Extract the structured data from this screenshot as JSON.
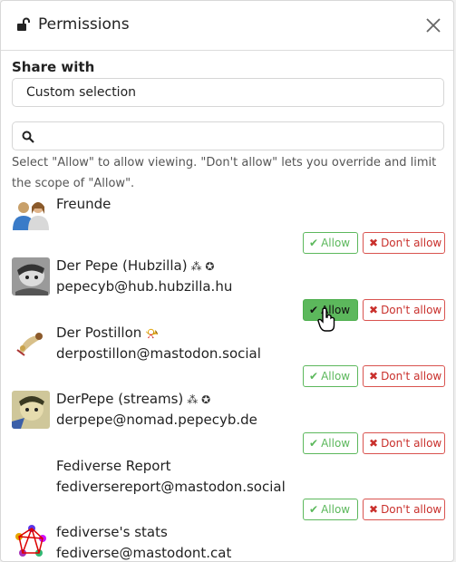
{
  "dialog": {
    "title": "Permissions",
    "share_with_label": "Share with",
    "share_select_value": "Custom selection",
    "search_placeholder": "",
    "help_text": "Select \"Allow\" to allow viewing. \"Don't allow\" lets you override and limit the scope of \"Allow\".",
    "allow_label": "Allow",
    "deny_label": "Don't allow",
    "icons": {
      "lock": "lock-open-icon",
      "close": "close-icon",
      "search": "search-icon",
      "check": "check-icon",
      "times": "times-icon"
    }
  },
  "contacts": [
    {
      "name": "Freunde",
      "handle": "",
      "badges": "",
      "allow_active": false
    },
    {
      "name": "Der Pepe (Hubzilla)",
      "handle": "pepecyb@hub.hubzilla.hu",
      "badges": "⁂ ✪",
      "allow_active": true
    },
    {
      "name": "Der Postillon",
      "handle": "derpostillon@mastodon.social",
      "badges": "📯",
      "allow_active": false
    },
    {
      "name": "DerPepe (streams)",
      "handle": "derpepe@nomad.pepecyb.de",
      "badges": "⁂ ✪",
      "allow_active": false
    },
    {
      "name": "Fediverse Report",
      "handle": "fediversereport@mastodon.social",
      "badges": "",
      "allow_active": false
    },
    {
      "name": "fediverse's stats",
      "handle": "fediverse@mastodont.cat",
      "badges": "",
      "allow_active": false
    }
  ],
  "colors": {
    "allow": "#5cb85c",
    "deny": "#d9534f"
  }
}
